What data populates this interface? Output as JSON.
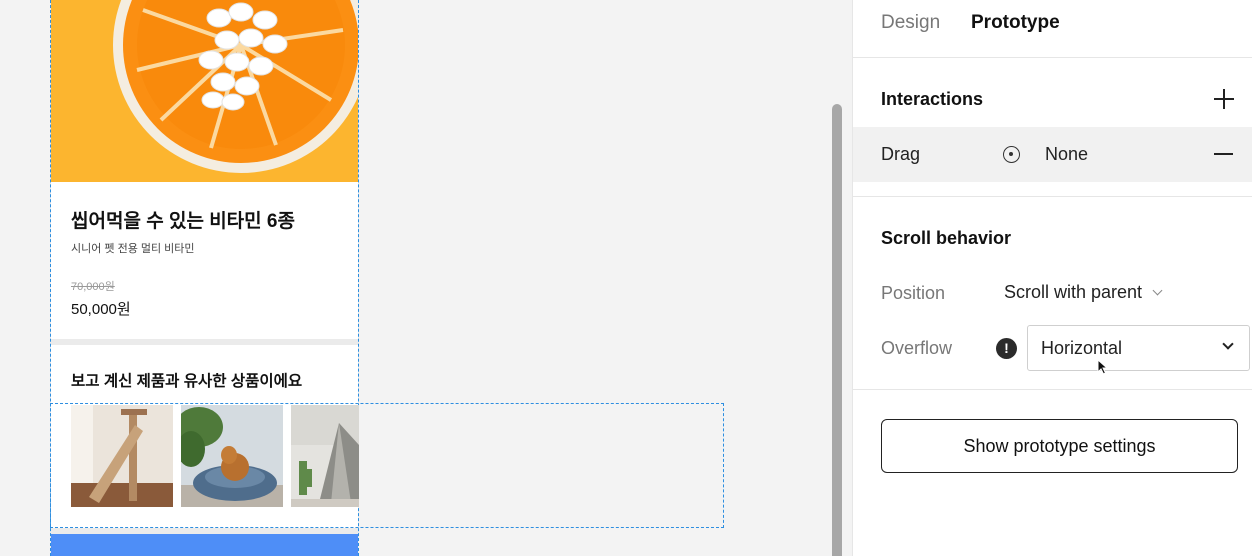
{
  "canvas": {
    "product": {
      "title": "씹어먹을 수 있는 비타민 6종",
      "subtitle": "시니어 펫 전용 멀티 비타민",
      "price_original": "70,000원",
      "price_sale": "50,000원"
    },
    "similar": {
      "title": "보고 계신 제품과 유사한 상품이에요"
    },
    "colors": {
      "hero_bg": "#fcb52f",
      "cta_bar": "#4e8ef7",
      "selection": "#2d8ee0"
    }
  },
  "panel": {
    "tabs": [
      {
        "label": "Design",
        "active": false
      },
      {
        "label": "Prototype",
        "active": true
      }
    ],
    "interactions": {
      "title": "Interactions",
      "add_icon": "plus-icon",
      "row": {
        "trigger": "Drag",
        "action_icon": "target-icon",
        "action": "None",
        "remove_icon": "minus-icon"
      }
    },
    "scroll": {
      "title": "Scroll behavior",
      "position_label": "Position",
      "position_value": "Scroll with parent",
      "overflow_label": "Overflow",
      "overflow_warning_icon": "warning-icon",
      "overflow_value": "Horizontal"
    },
    "settings_button": "Show prototype settings"
  }
}
